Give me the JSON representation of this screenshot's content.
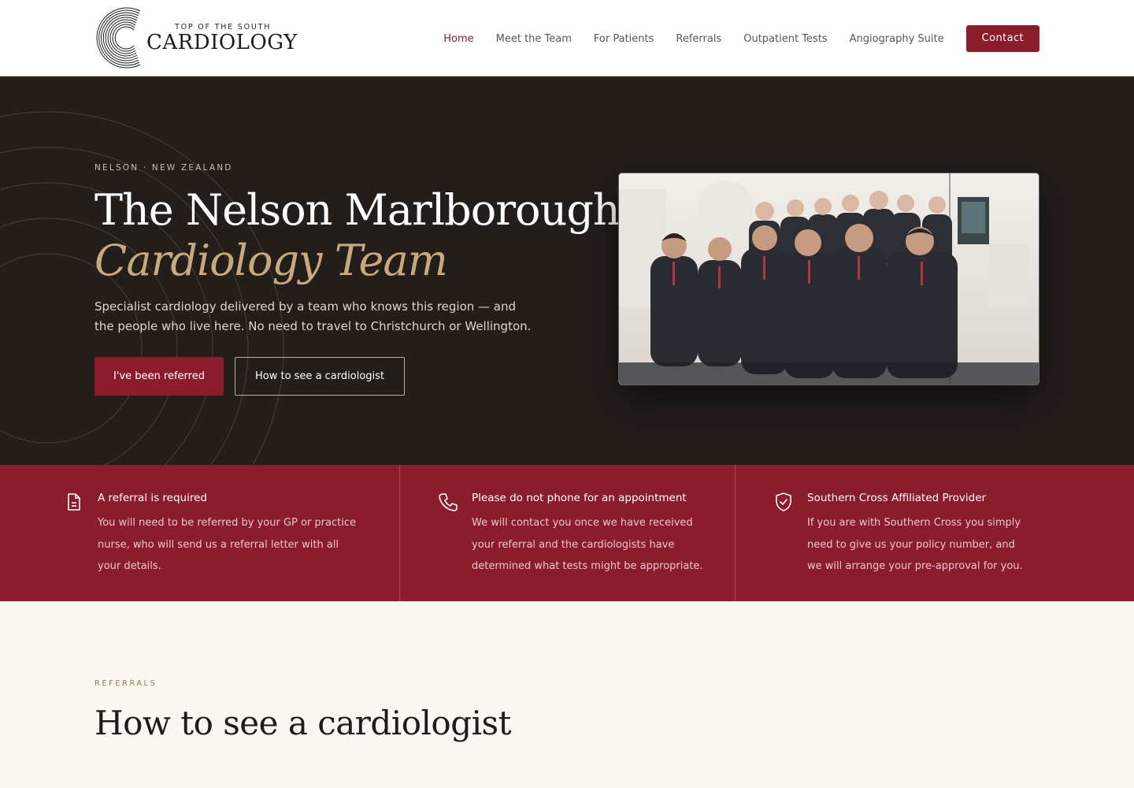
{
  "brand": {
    "logo_top": "TOP OF THE SOUTH",
    "logo_main": "CARDIOLOGY"
  },
  "nav": {
    "items": [
      {
        "label": "Home",
        "active": true
      },
      {
        "label": "Meet the Team",
        "active": false
      },
      {
        "label": "For Patients",
        "active": false
      },
      {
        "label": "Referrals",
        "active": false
      },
      {
        "label": "Outpatient Tests",
        "active": false
      },
      {
        "label": "Angiography Suite",
        "active": false
      }
    ],
    "contact_label": "Contact"
  },
  "hero": {
    "eyebrow": "NELSON · NEW ZEALAND",
    "title_line1": "The Nelson Marlborough",
    "title_line2": "Cardiology Team",
    "subtitle": "Specialist cardiology delivered by a team who knows this region — and the people who live here. No need to travel to Christchurch or Wellington.",
    "primary_button": "I've been referred",
    "secondary_button": "How to see a cardiologist"
  },
  "info": [
    {
      "icon": "document-icon",
      "title": "A referral is required",
      "text": "You will need to be referred by your GP or practice nurse, who will send us a referral letter with all your details."
    },
    {
      "icon": "phone-icon",
      "title": "Please do not phone for an appointment",
      "text": "We will contact you once we have received your referral and the cardiologists have determined what tests might be appropriate."
    },
    {
      "icon": "shield-check-icon",
      "title": "Southern Cross Affiliated Provider",
      "text": "If you are with Southern Cross you simply need to give us your policy number, and we will arrange your pre-approval for you."
    }
  ],
  "referrals": {
    "eyebrow": "REFERRALS",
    "title": "How to see a cardiologist"
  },
  "colors": {
    "accent": "#8b1c2c",
    "hero_bg": "#241e1b",
    "gold": "#c8a97e",
    "page_bg": "#faf7f2"
  }
}
